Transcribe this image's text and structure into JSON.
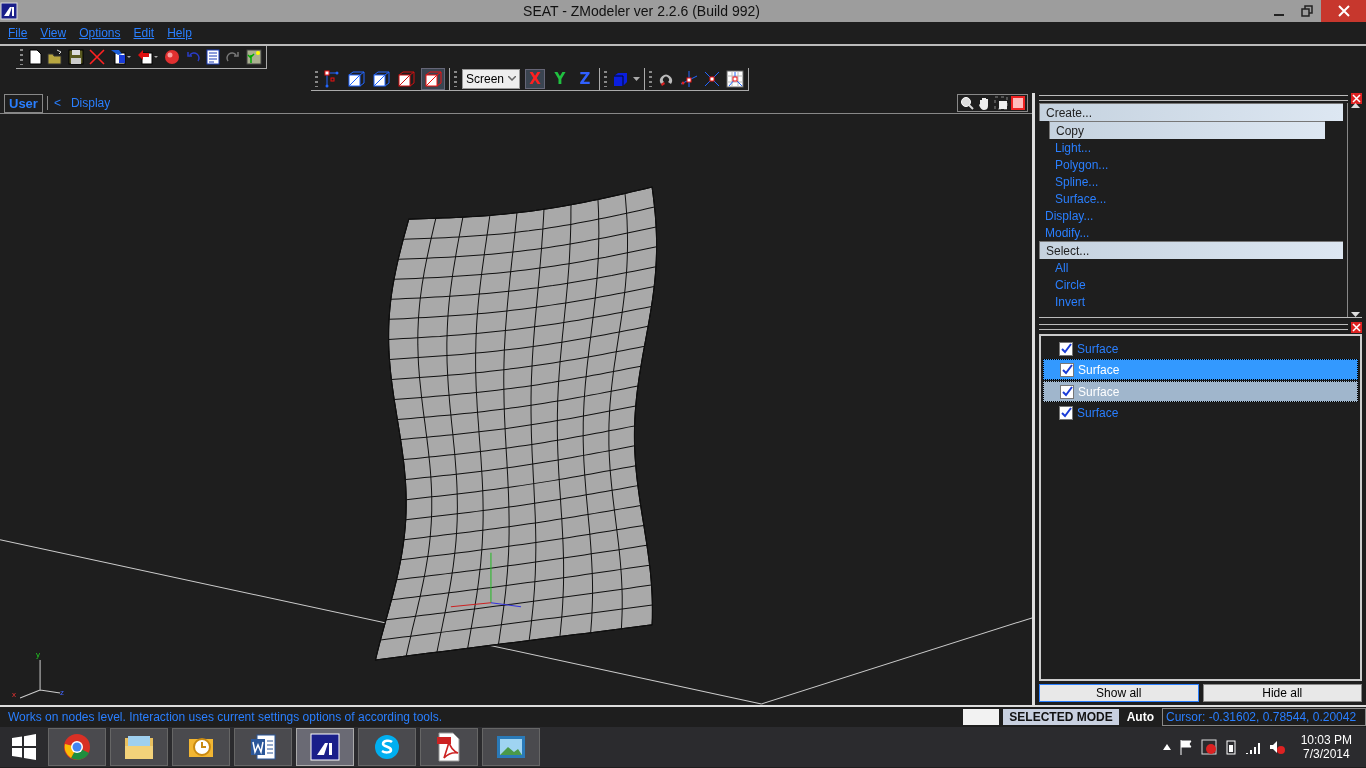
{
  "window": {
    "title": "SEAT - ZModeler ver 2.2.6 (Build 992)"
  },
  "menu": [
    {
      "label": "File"
    },
    {
      "label": "View"
    },
    {
      "label": "Options"
    },
    {
      "label": "Edit"
    },
    {
      "label": "Help"
    }
  ],
  "toolbar": {
    "coordinate_system": "Screen",
    "axes": [
      {
        "label": "X",
        "selected": true
      },
      {
        "label": "Y",
        "selected": false
      },
      {
        "label": "Z",
        "selected": false
      }
    ]
  },
  "viewport": {
    "tab": "User",
    "back": "<",
    "breadcrumb": "Display",
    "axis_labels": [
      "y",
      "x",
      "z"
    ]
  },
  "command_tree": [
    {
      "label": "Create...",
      "expanded": true,
      "children": [
        {
          "label": "Copy",
          "selected": true
        },
        {
          "label": "Light...",
          "selected": false
        },
        {
          "label": "Polygon...",
          "selected": false
        },
        {
          "label": "Spline...",
          "selected": false
        },
        {
          "label": "Surface...",
          "selected": false
        }
      ]
    },
    {
      "label": "Display...",
      "expanded": false
    },
    {
      "label": "Modify...",
      "expanded": false
    },
    {
      "label": "Select...",
      "expanded": true,
      "children": [
        {
          "label": "All",
          "selected": false
        },
        {
          "label": "Circle",
          "selected": false
        },
        {
          "label": "Invert",
          "selected": false
        }
      ]
    }
  ],
  "layers": [
    {
      "label": "Surface",
      "checked": true,
      "selected": false,
      "active": false
    },
    {
      "label": "Surface",
      "checked": true,
      "selected": true,
      "active": true
    },
    {
      "label": "Surface",
      "checked": true,
      "selected": true,
      "active": false
    },
    {
      "label": "Surface",
      "checked": true,
      "selected": false,
      "active": false
    }
  ],
  "layer_buttons": [
    "Show all",
    "Hide all"
  ],
  "status_bar": {
    "message": "Works on nodes level. Interaction uses current settings options of according tools.",
    "mode": "SELECTED MODE",
    "snap": "Auto",
    "cursor": "Cursor: -0.31602, 0.78544, 0.20042"
  },
  "taskbar": {
    "apps": [
      {
        "kind": "browser",
        "selected": false
      },
      {
        "kind": "folder",
        "selected": false
      },
      {
        "kind": "mail",
        "selected": false
      },
      {
        "kind": "word",
        "selected": false
      },
      {
        "kind": "modeler",
        "selected": true
      },
      {
        "kind": "chat",
        "selected": false
      },
      {
        "kind": "pdf",
        "selected": false
      },
      {
        "kind": "photos",
        "selected": false
      }
    ],
    "time": "10:03 PM",
    "date": "7/3/2014"
  }
}
